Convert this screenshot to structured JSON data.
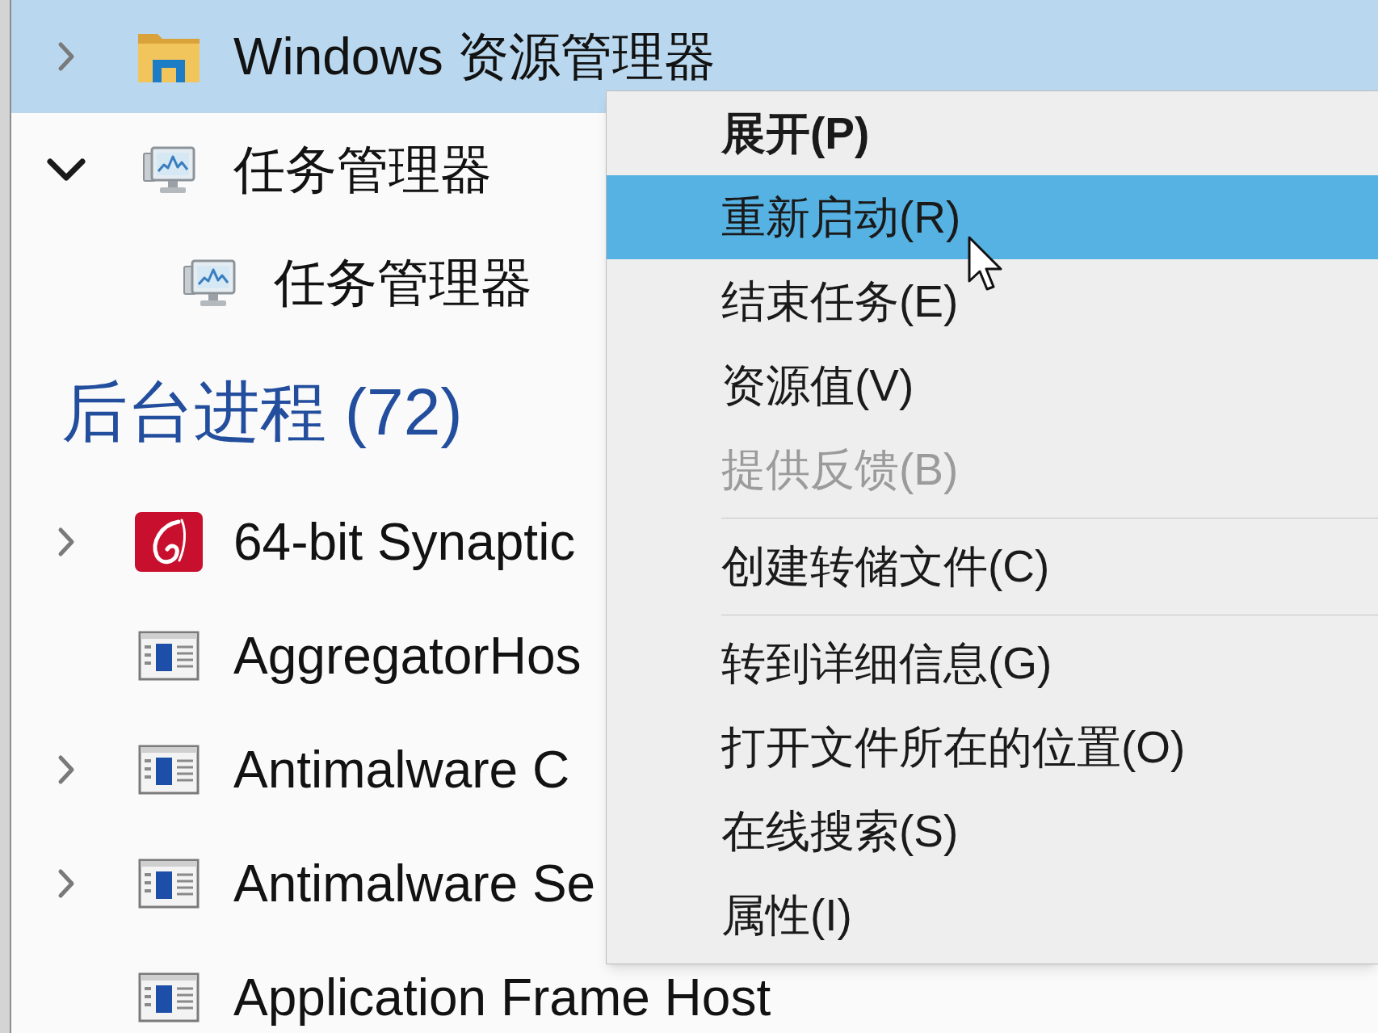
{
  "process_list": {
    "rows": [
      {
        "kind": "folder",
        "name": "Windows 资源管理器",
        "expanded": false,
        "selected": true
      },
      {
        "kind": "monitor",
        "name": "任务管理器",
        "expanded": true,
        "selected": false,
        "children": [
          {
            "kind": "monitor",
            "name": "任务管理器",
            "selected": false
          }
        ]
      }
    ]
  },
  "background_group": {
    "title": "后台进程 (72)",
    "rows": [
      {
        "kind": "swirl",
        "name": "64-bit Synaptic",
        "expanded": false,
        "selected": false
      },
      {
        "kind": "window",
        "name": "AggregatorHos",
        "selected": false
      },
      {
        "kind": "window",
        "name": "Antimalware C",
        "expanded": false,
        "selected": false
      },
      {
        "kind": "window",
        "name": "Antimalware Se",
        "expanded": false,
        "selected": false
      },
      {
        "kind": "window",
        "name": "Application Frame Host",
        "selected": false
      }
    ]
  },
  "context_menu": {
    "items": [
      {
        "kind": "item",
        "label": "展开(P)",
        "default": true,
        "disabled": false,
        "selected": false
      },
      {
        "kind": "item",
        "label": "重新启动(R)",
        "default": false,
        "disabled": false,
        "selected": true
      },
      {
        "kind": "item",
        "label": "结束任务(E)",
        "default": false,
        "disabled": false,
        "selected": false
      },
      {
        "kind": "item",
        "label": "资源值(V)",
        "default": false,
        "disabled": false,
        "selected": false
      },
      {
        "kind": "item",
        "label": "提供反馈(B)",
        "default": false,
        "disabled": true,
        "selected": false
      },
      {
        "kind": "separator"
      },
      {
        "kind": "item",
        "label": "创建转储文件(C)",
        "default": false,
        "disabled": false,
        "selected": false
      },
      {
        "kind": "separator"
      },
      {
        "kind": "item",
        "label": "转到详细信息(G)",
        "default": false,
        "disabled": false,
        "selected": false
      },
      {
        "kind": "item",
        "label": "打开文件所在的位置(O)",
        "default": false,
        "disabled": false,
        "selected": false
      },
      {
        "kind": "item",
        "label": "在线搜索(S)",
        "default": false,
        "disabled": false,
        "selected": false
      },
      {
        "kind": "item",
        "label": "属性(I)",
        "default": false,
        "disabled": false,
        "selected": false
      }
    ]
  }
}
